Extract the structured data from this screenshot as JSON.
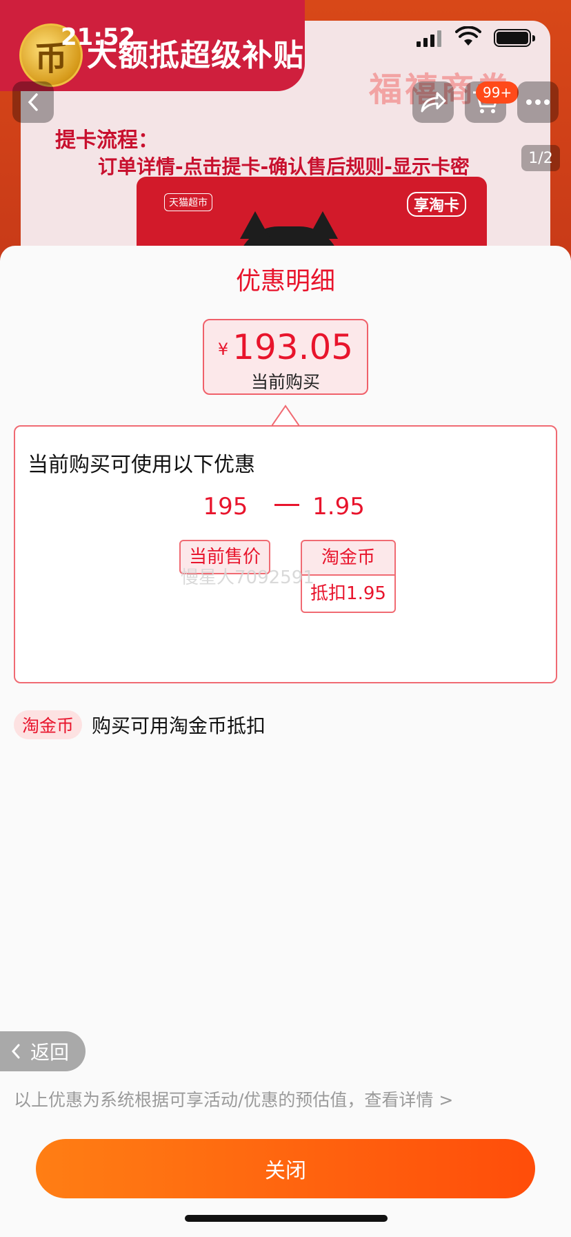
{
  "status_bar": {
    "time": "21:52"
  },
  "banner": {
    "coin_symbol": "币",
    "promo_text": "大额抵超级补贴",
    "brand": "福禧商券",
    "flow_title": "提卡流程：",
    "flow_steps": "订单详情-点击提卡-确认售后规则-显示卡密",
    "card_logo_left": "天猫超市",
    "card_logo_right": "享淘卡"
  },
  "nav": {
    "back_icon": "chevron-left-icon",
    "share_icon": "share-icon",
    "cart_icon": "cart-icon",
    "more_icon": "more-icon",
    "cart_badge": "99+",
    "page_indicator": "1/2"
  },
  "sheet": {
    "title": "优惠明细",
    "price": {
      "symbol": "¥",
      "value": "193.05",
      "caption": "当前购买"
    },
    "detail": {
      "heading": "当前购买可使用以下优惠",
      "base_value": "195",
      "base_label": "当前售价",
      "minus": "–",
      "discount_value": "1.95",
      "discount_label": "淘金币",
      "discount_sub": "抵扣1.95"
    },
    "watermark": "慢星人7092591",
    "coin_tag": "淘金币",
    "coin_text": "购买可用淘金币抵扣",
    "return_label": "返回",
    "disclaimer": "以上优惠为系统根据可享活动/优惠的预估值，查看详情 >",
    "close_label": "关闭"
  },
  "colors": {
    "accent_red": "#e8142c",
    "button_orange_start": "#ff7e14",
    "button_orange_end": "#ff4d0a"
  }
}
